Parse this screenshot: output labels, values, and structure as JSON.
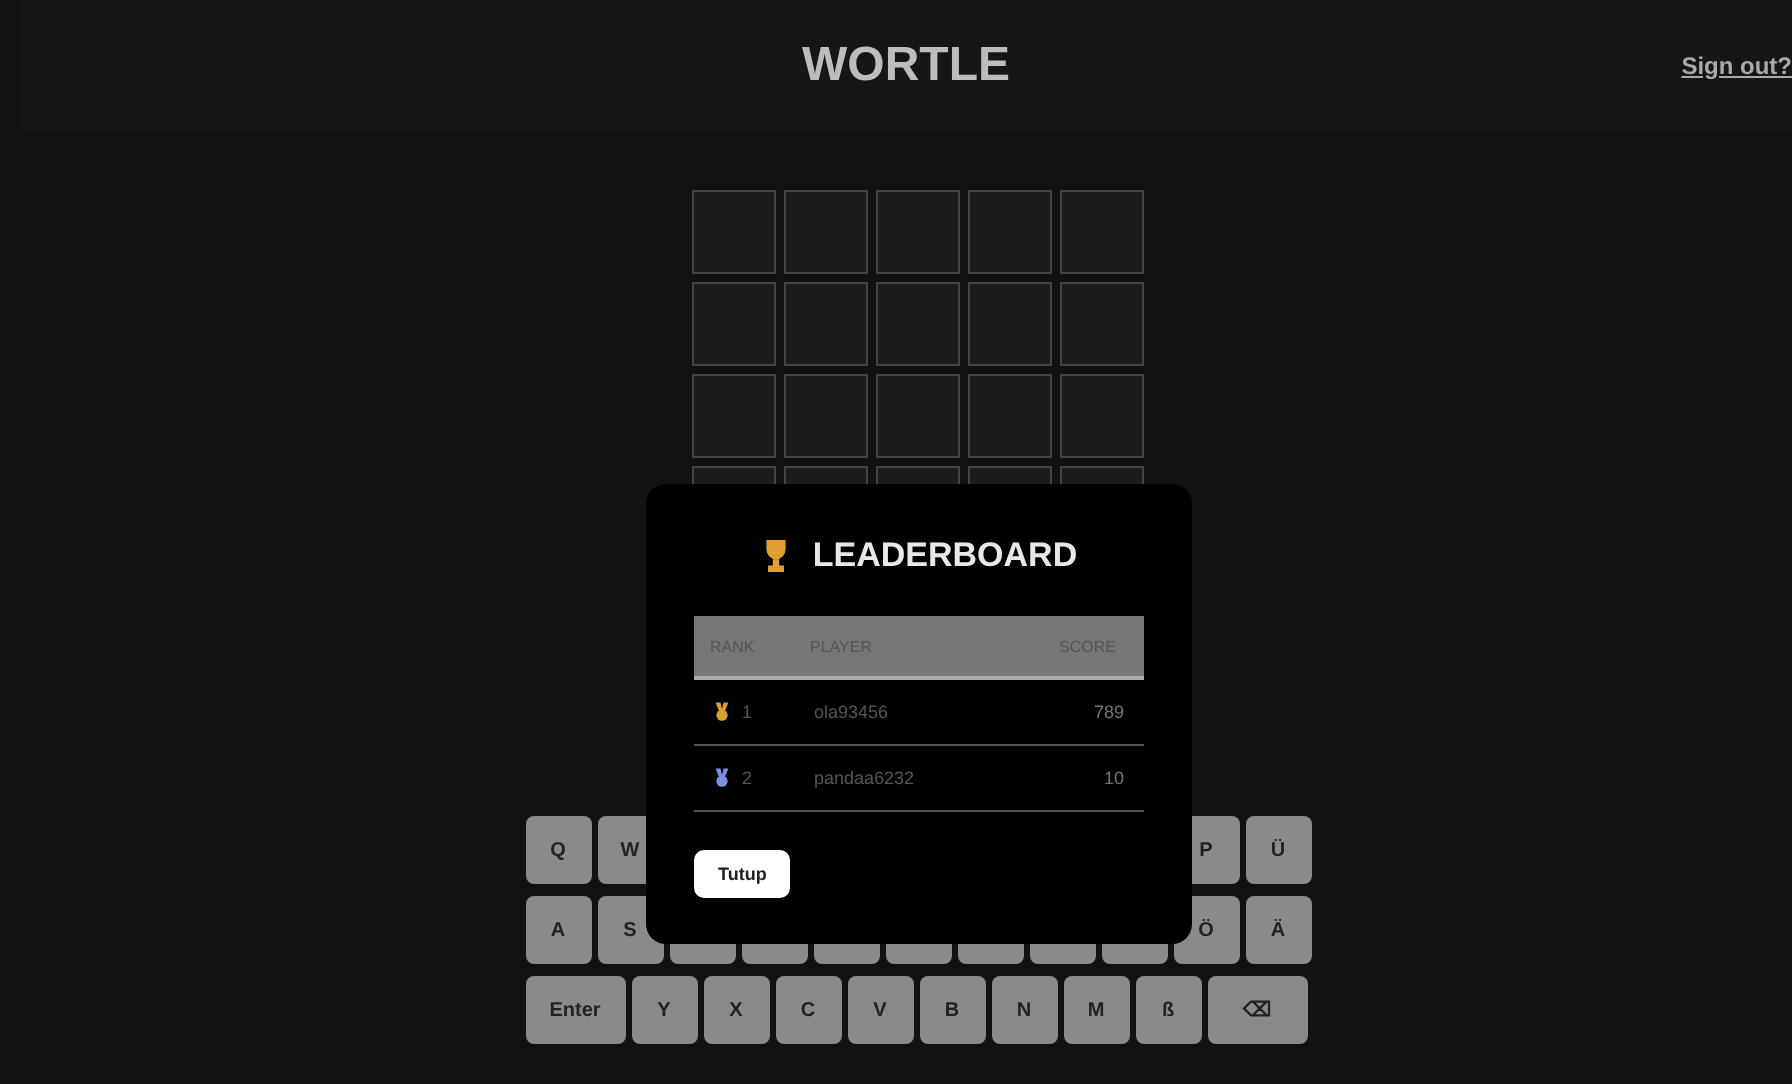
{
  "header": {
    "title": "WORTLE",
    "sign_out": "Sign out?"
  },
  "board": {
    "rows": [
      [
        {},
        {},
        {},
        {},
        {}
      ],
      [
        {},
        {},
        {},
        {},
        {}
      ],
      [
        {},
        {},
        {},
        {},
        {}
      ],
      [
        {},
        {},
        {},
        {},
        {}
      ]
    ]
  },
  "keyboard": [
    {
      "left": [
        {
          "label": "Q"
        },
        {
          "label": "W"
        }
      ],
      "right": [
        {
          "label": "P"
        },
        {
          "label": "Ü"
        }
      ]
    },
    {
      "left": [
        {
          "label": "A"
        },
        {
          "label": "S"
        }
      ],
      "right": [
        {
          "label": "Ö"
        },
        {
          "label": "Ä"
        }
      ]
    },
    {
      "keys": [
        {
          "label": "Enter",
          "kind": "wide"
        },
        {
          "label": "Y"
        },
        {
          "label": "X"
        },
        {
          "label": "C"
        },
        {
          "label": "V"
        },
        {
          "label": "B"
        },
        {
          "label": "N"
        },
        {
          "label": "M"
        },
        {
          "label": "ß"
        },
        {
          "label": "⌫",
          "kind": "wide"
        }
      ]
    }
  ],
  "leaderboard": {
    "title": "LEADERBOARD",
    "columns": [
      "RANK",
      "PLAYER",
      "SCORE"
    ],
    "rows": [
      {
        "color": "#d9a030",
        "rank": "1",
        "player": "ola93456",
        "score": "789"
      },
      {
        "color": "#8090e0",
        "rank": "2",
        "player": "pandaa6232",
        "score": "10"
      }
    ],
    "close_button": "Tutup"
  }
}
